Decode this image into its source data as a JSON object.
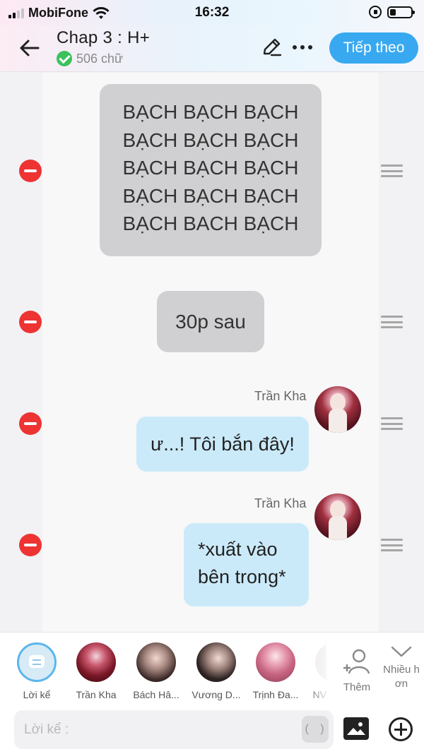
{
  "status_bar": {
    "carrier": "MobiFone",
    "time": "16:32"
  },
  "header": {
    "title": "Chap 3 : H+",
    "word_count": "506 chữ",
    "next_label": "Tiếp theo",
    "accent_color": "#38a9f0"
  },
  "messages": [
    {
      "type": "narration",
      "text": "BẠCH BẠCH BẠCH\nBẠCH BẠCH BẠCH\nBẠCH BẠCH BẠCH\nBẠCH BẠCH BẠCH\nBẠCH BACH BẠCH"
    },
    {
      "type": "narration",
      "text": "30p sau"
    },
    {
      "type": "character",
      "speaker": "Trần Kha",
      "text": "ư...! Tôi bắn đây!"
    },
    {
      "type": "character",
      "speaker": "Trần Kha",
      "text": "*xuất vào\nbên trong*"
    }
  ],
  "characters": [
    {
      "name": "Lời kể",
      "icon": "narrator-icon"
    },
    {
      "name": "Trần Kha"
    },
    {
      "name": "Bách Hâ..."
    },
    {
      "name": "Vương D..."
    },
    {
      "name": "Trịnh Đa..."
    },
    {
      "name": "NV"
    }
  ],
  "add_character_label": "Thêm",
  "collapse_label": "Nhiều h\nơn",
  "composer": {
    "placeholder": "Lời kể :",
    "paren_label": "( )"
  }
}
